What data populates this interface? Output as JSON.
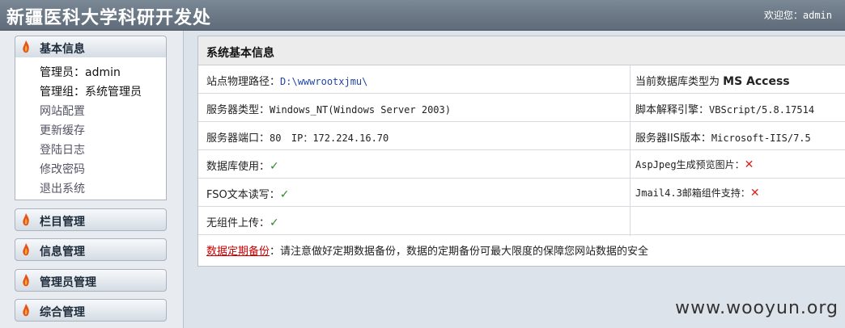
{
  "header": {
    "title": "新疆医科大学科研开发处",
    "welcome_prefix": "欢迎您：",
    "username": "admin"
  },
  "sidebar": {
    "basic": {
      "title": "基本信息",
      "items": [
        {
          "label": "管理员：admin"
        },
        {
          "label": "管理组：系统管理员"
        },
        {
          "label": "网站配置"
        },
        {
          "label": "更新缓存"
        },
        {
          "label": "登陆日志"
        },
        {
          "label": "修改密码"
        },
        {
          "label": "退出系统"
        }
      ]
    },
    "sections": [
      {
        "label": "栏目管理"
      },
      {
        "label": "信息管理"
      },
      {
        "label": "管理员管理"
      },
      {
        "label": "综合管理"
      }
    ]
  },
  "panel": {
    "title": "系统基本信息",
    "site_path_label": "站点物理路径：",
    "site_path": "D:\\wwwrootxjmu\\",
    "db_type_prefix": "当前数据库类型为",
    "db_type": "MS Access",
    "server_type_label": "服务器类型：",
    "server_type": "Windows_NT(Windows Server 2003)",
    "script_engine_label": "脚本解释引擎：",
    "script_engine": "VBScript/5.8.17514",
    "port_label": "服务器端口：",
    "port": "80",
    "ip_label": "IP：",
    "ip": "172.224.16.70",
    "iis_label": "服务器IIS版本：",
    "iis": "Microsoft-IIS/7.5",
    "db_usage_label": "数据库使用：",
    "aspjpeg_label": "AspJpeg生成预览图片：",
    "fso_label": "FSO文本读写：",
    "jmail_label": "Jmail4.3邮箱组件支持：",
    "upload_label": "无组件上传：",
    "check_mark": "✓",
    "cross_mark": "✕",
    "backup_link": "数据定期备份",
    "backup_note": "：请注意做好定期数据备份，数据的定期备份可最大限度的保障您网站数据的安全"
  },
  "watermark": "www.wooyun.org"
}
